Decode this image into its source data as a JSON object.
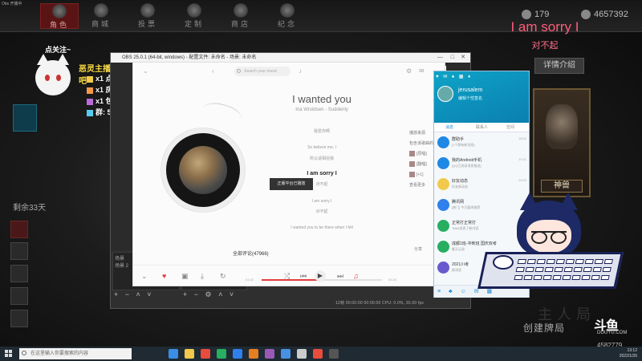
{
  "stream_label": "Obs 开播中",
  "game": {
    "tabs": [
      {
        "label": "角色",
        "active": true
      },
      {
        "label": "商城"
      },
      {
        "label": "投票"
      },
      {
        "label": "定制"
      },
      {
        "label": "商店"
      },
      {
        "label": "纪念"
      }
    ],
    "stats": {
      "left": "179",
      "right": "4657392"
    },
    "detail_button": "详情介绍",
    "lyric_en": "I am sorry I",
    "lyric_zh": "对不起",
    "card_name": "神兽",
    "days_left": "剩余33天",
    "create_deck": "创建牌局",
    "ghost_text": "主人局"
  },
  "overlay": {
    "follow": "点关注~",
    "title": "恶灵主播，关注我吧",
    "lines": [
      {
        "text": "x1 点鬼",
        "color": "#f2c94c"
      },
      {
        "text": "x1 房管",
        "color": "#f2994a"
      },
      {
        "text": "x1 包赛季双一",
        "color": "#bb6bd9"
      },
      {
        "text": "群: 573304714",
        "color": "#56ccf2"
      }
    ]
  },
  "obs": {
    "title": "OBS 25.0.1 (64-bit, windows) - 配置文件: 未命名 - 场景: 未命名",
    "dock": {
      "scenes_header": "场景",
      "scene_item": "场景 2"
    },
    "status": "12帧  00:00:00   00:00:00   CPU: 0.0%, 30.00 fps"
  },
  "player": {
    "search_placeholder": "Search your music",
    "song_title": "I wanted you",
    "song_artist": "Ina Wroldsen - Suddenly",
    "lyrics": [
      {
        "text": "我爱你啊",
        "hl": false
      },
      {
        "text": "So believe me, I",
        "hl": false
      },
      {
        "text": "所以请相信我",
        "hl": false
      },
      {
        "text": "I am sorry I",
        "hl": true
      },
      {
        "text": "对不起",
        "hl": false
      },
      {
        "text": "I am sorry I",
        "hl": false
      },
      {
        "text": "对不起",
        "hl": false
      },
      {
        "text": "I wanted you to be there when I fell",
        "hl": false
      }
    ],
    "toast": "正版平台已播放",
    "side_header": "播放来源",
    "side_items": [
      "包含该歌曲的歌单",
      "[原唱]",
      "[翻唱]",
      "[+1]",
      "查看更多"
    ],
    "comments": "全部评论(47966)",
    "share": "分享",
    "time_left": "01:42",
    "time_right": "03:20",
    "progress": 0.51
  },
  "qq": {
    "header_icons": "♥ ✉ ♠ ▦ ♦",
    "name": "jerusalem",
    "signature": "编辑个性签名",
    "tabs": [
      "消息",
      "联系人",
      "空间"
    ],
    "items": [
      {
        "name": "群助手",
        "msg": "[1个群有新消息]",
        "time": "18:02",
        "color": "#1e88e5"
      },
      {
        "name": "我的Android手机",
        "msg": "[QQ已关闭消息推送]",
        "time": "10:11",
        "color": "#1e88e5"
      },
      {
        "name": "好友动态",
        "msg": "好友新动态",
        "time": "10:02",
        "color": "#f2c94c"
      },
      {
        "name": "腾讯网",
        "msg": "[热门] 今日要闻推荐",
        "time": "",
        "color": "#2f80ed"
      },
      {
        "name": "正常打正常打",
        "msg": "Toilet发表了新内容",
        "time": "",
        "color": "#27ae60"
      },
      {
        "name": "成都1班-冲刺班 国庆双考",
        "msg": "聊天记录",
        "time": "",
        "color": "#27ae60"
      },
      {
        "name": "2021川考",
        "msg": "群消息",
        "time": "",
        "color": "#6a5acd"
      }
    ],
    "footer_icons": "≡ ♣ ☺ ✉ ▦"
  },
  "douyu": {
    "logo": "斗鱼",
    "sub": "DOUYU.COM",
    "room": "4582779"
  },
  "taskbar": {
    "search_placeholder": "在这里输入你要搜索的内容",
    "clock_time": "13:12",
    "clock_date": "2022/1/26",
    "apps": [
      "#3a8ee6",
      "#f2c94c",
      "#e74c3c",
      "#27ae60",
      "#2f80ed",
      "#e67e22",
      "#9b59b6",
      "#4a90e2",
      "#ccc",
      "#e74c3c",
      "#555"
    ]
  }
}
